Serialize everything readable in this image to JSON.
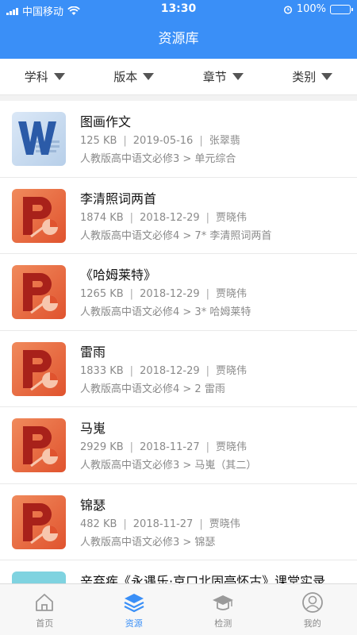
{
  "status_bar": {
    "carrier": "中国移动",
    "time": "13:30",
    "battery": "100%"
  },
  "header": {
    "title": "资源库"
  },
  "filters": [
    "学科",
    "版本",
    "章节",
    "类别"
  ],
  "resources": [
    {
      "title": "图画作文",
      "size": "125 KB",
      "date": "2019-05-16",
      "author": "张翠翡",
      "path": "人教版高中语文必修3 > 单元综合",
      "type": "word"
    },
    {
      "title": "李清照词两首",
      "size": "1874 KB",
      "date": "2018-12-29",
      "author": "贾晓伟",
      "path": "人教版高中语文必修4 > 7* 李清照词两首",
      "type": "ppt"
    },
    {
      "title": "《哈姆莱特》",
      "size": "1265 KB",
      "date": "2018-12-29",
      "author": "贾晓伟",
      "path": "人教版高中语文必修4 > 3* 哈姆莱特",
      "type": "ppt"
    },
    {
      "title": "雷雨",
      "size": "1833 KB",
      "date": "2018-12-29",
      "author": "贾晓伟",
      "path": "人教版高中语文必修4 > 2 雷雨",
      "type": "ppt"
    },
    {
      "title": "马嵬",
      "size": "2929 KB",
      "date": "2018-11-27",
      "author": "贾晓伟",
      "path": "人教版高中语文必修3 > 马嵬（其二）",
      "type": "ppt"
    },
    {
      "title": "锦瑟",
      "size": "482 KB",
      "date": "2018-11-27",
      "author": "贾晓伟",
      "path": "人教版高中语文必修3 > 锦瑟",
      "type": "ppt"
    },
    {
      "title": "辛弃疾《永遇乐·京口北固亭怀古》课堂实录",
      "type": "video"
    }
  ],
  "tabs": [
    {
      "label": "首页",
      "icon": "home-icon",
      "active": false
    },
    {
      "label": "资源",
      "icon": "layers-icon",
      "active": true
    },
    {
      "label": "检测",
      "icon": "graduation-cap-icon",
      "active": false
    },
    {
      "label": "我的",
      "icon": "user-icon",
      "active": false
    }
  ],
  "colors": {
    "accent": "#3a8ff7",
    "ppt": "#e8613b",
    "word": "#2b5ba8",
    "video": "#7fd3e0"
  }
}
